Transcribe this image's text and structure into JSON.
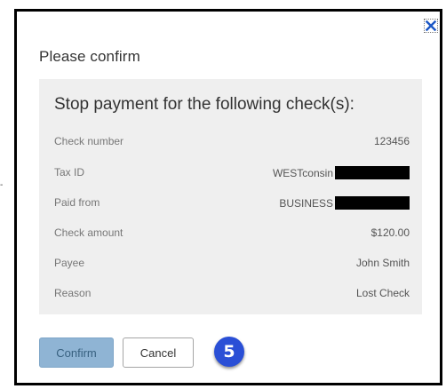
{
  "dialog": {
    "title": "Please confirm",
    "close_icon": "close-icon",
    "heading": "Stop payment for the following check(s):",
    "details": [
      {
        "label": "Check number",
        "value": "123456",
        "redacted": false
      },
      {
        "label": "Tax ID",
        "value": "WESTconsin",
        "redacted": true
      },
      {
        "label": "Paid from",
        "value": "BUSINESS",
        "redacted": true
      },
      {
        "label": "Check amount",
        "value": "$120.00",
        "redacted": false
      },
      {
        "label": "Payee",
        "value": "John Smith",
        "redacted": false
      },
      {
        "label": "Reason",
        "value": "Lost Check",
        "redacted": false
      }
    ],
    "confirm_label": "Confirm",
    "cancel_label": "Cancel",
    "step_badge": "5"
  },
  "colors": {
    "panel_bg": "#efefef",
    "confirm_bg": "#8fb4d4",
    "badge_bg": "#2a4fd6",
    "close_icon": "#1a56c4"
  }
}
